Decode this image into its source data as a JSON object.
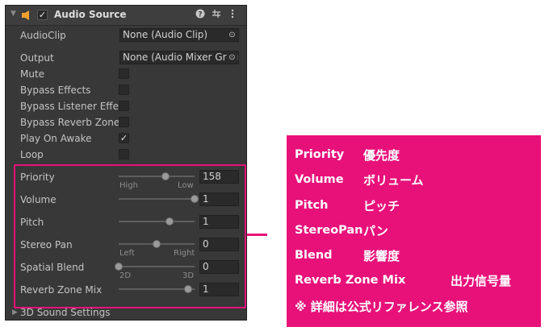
{
  "component": {
    "title": "Audio Source",
    "enabled": true,
    "help_icon": "help-icon",
    "preset_icon": "preset-icon",
    "menu_icon": "kebab-menu-icon"
  },
  "fields": {
    "audio_clip": {
      "label": "AudioClip",
      "value": "None (Audio Clip)"
    },
    "output": {
      "label": "Output",
      "value": "None (Audio Mixer Grou"
    },
    "mute": {
      "label": "Mute",
      "checked": false
    },
    "bypass_effects": {
      "label": "Bypass Effects",
      "checked": false
    },
    "bypass_listener": {
      "label": "Bypass Listener Effec",
      "checked": false
    },
    "bypass_reverb": {
      "label": "Bypass Reverb Zones",
      "checked": false
    },
    "play_on_awake": {
      "label": "Play On Awake",
      "checked": true,
      "check_mark": "✓"
    },
    "loop": {
      "label": "Loop",
      "checked": false
    }
  },
  "sliders": {
    "priority": {
      "label": "Priority",
      "value": "158",
      "low_label": "High",
      "high_label": "Low",
      "fraction": 0.62
    },
    "volume": {
      "label": "Volume",
      "value": "1",
      "fraction": 1.0
    },
    "pitch": {
      "label": "Pitch",
      "value": "1",
      "fraction": 0.67
    },
    "stereo_pan": {
      "label": "Stereo Pan",
      "value": "0",
      "low_label": "Left",
      "high_label": "Right",
      "fraction": 0.5
    },
    "spatial_blend": {
      "label": "Spatial Blend",
      "value": "0",
      "low_label": "2D",
      "high_label": "3D",
      "fraction": 0.0
    },
    "reverb_zone_mix": {
      "label": "Reverb Zone Mix",
      "value": "1",
      "fraction": 0.91
    }
  },
  "footer": {
    "label": "3D Sound Settings"
  },
  "callout": {
    "accent_color": "#e8117a",
    "rows": [
      {
        "term": "Priority",
        "meaning": "優先度"
      },
      {
        "term": "Volume",
        "meaning": "ボリューム"
      },
      {
        "term": "Pitch",
        "meaning": "ピッチ"
      },
      {
        "term": "StereoPan",
        "meaning": "パン"
      },
      {
        "term": "Blend",
        "meaning": "影響度"
      },
      {
        "term": "Reverb Zone Mix",
        "meaning": "出力信号量"
      }
    ],
    "note": "※ 詳細は公式リファレンス参照"
  }
}
